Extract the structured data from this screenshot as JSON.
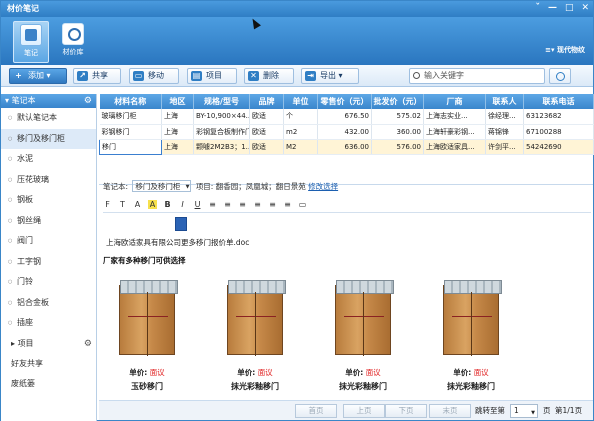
{
  "window": {
    "title": "材价笔记",
    "buttons": [
      "ˇ",
      "—",
      "□",
      "✕"
    ]
  },
  "ribbon": {
    "tabs": [
      {
        "label": "笔记"
      },
      {
        "label": "材价库"
      }
    ],
    "style_label": "现代物纹"
  },
  "toolbar": {
    "add": "添加",
    "share": "共享",
    "move": "移动",
    "project": "项目",
    "delete": "删除",
    "export": "导出",
    "search_placeholder": "输入关键字"
  },
  "sidebar": {
    "header": "笔记本",
    "items": [
      "默认笔记本",
      "移门及移门柜",
      "水泥",
      "压花玻璃",
      "钢板",
      "钢丝绳",
      "阀门",
      "工字钢",
      "门铃",
      "铝合金板",
      "插座"
    ],
    "selected_index": 1,
    "sections": [
      "项目",
      "好友共享",
      "废纸篓"
    ]
  },
  "table": {
    "headers": [
      "材料名称",
      "地区",
      "规格/型号",
      "品牌",
      "单位",
      "零售价（元）",
      "批发价（元）",
      "厂商",
      "联系人",
      "联系电话"
    ],
    "rows": [
      [
        "玻璃移门柜",
        "上海",
        "BY-10,900×44...",
        "欧适",
        "个",
        "676.50",
        "575.02",
        "上海志实业...",
        "徐经理...",
        "63123682"
      ],
      [
        "彩钢移门",
        "上海",
        "彩钢复合板制作门",
        "欧适",
        "m2",
        "432.00",
        "360.00",
        "上海轩豪彩钢...",
        "蒋锦锋",
        "67100288"
      ],
      [
        "移门",
        "上海",
        "颗噱2M2B3；1...",
        "欧适",
        "M2",
        "636.00",
        "576.00",
        "上海欧适家具...",
        "许剑平...",
        "54242690"
      ]
    ],
    "highlight_row": 2
  },
  "meta": {
    "notebook_label": "笔记本:",
    "notebook_value": "移门及移门柜",
    "project_label": "项目: 翻香园；凤凰城；翻日景苑",
    "modify_link": "修改选择"
  },
  "format_bar": [
    "F",
    "T",
    "A",
    "A",
    "B",
    "I",
    "U",
    "≡",
    "≡",
    "≡",
    "≡",
    "≡",
    "≡",
    "▭"
  ],
  "editor": {
    "attachment": "上海欧适家具有限公司更多移门报价单.doc",
    "headline": "厂家有多种移门可供选择",
    "products": [
      {
        "price_label": "单价:",
        "price_value": "面议",
        "name": "玉砂移门"
      },
      {
        "price_label": "单价:",
        "price_value": "面议",
        "name": "抹光彩釉移门"
      },
      {
        "price_label": "单价:",
        "price_value": "面议",
        "name": "抹光彩釉移门"
      },
      {
        "price_label": "单价:",
        "price_value": "面议",
        "name": "抹光彩釉移门"
      }
    ]
  },
  "pager": {
    "first": "首页",
    "prev": "上页",
    "next": "下页",
    "last": "末页",
    "jump": "跳转至第",
    "page_value": "1",
    "page_unit": "页",
    "page_info": "第1/1页"
  }
}
